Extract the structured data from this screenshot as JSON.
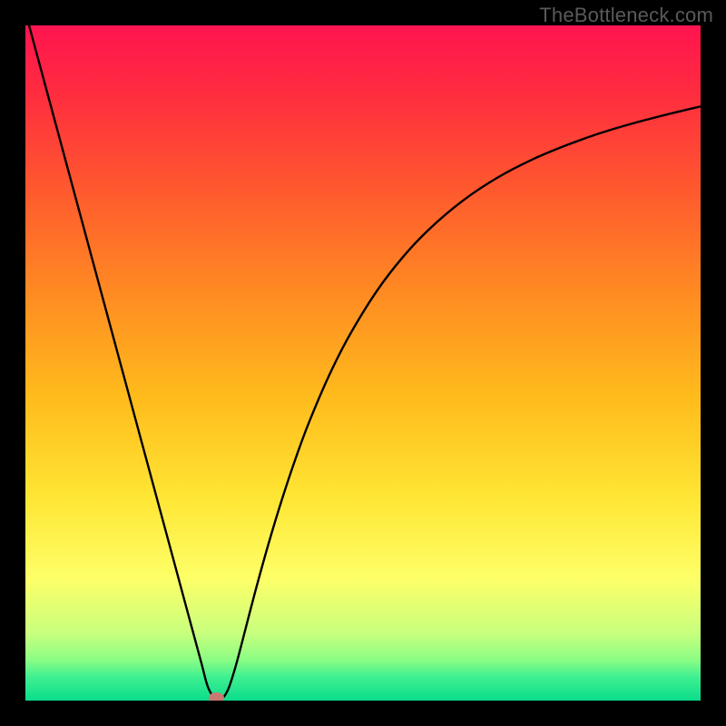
{
  "watermark": "TheBottleneck.com",
  "chart_data": {
    "type": "line",
    "title": "",
    "xlabel": "",
    "ylabel": "",
    "xlim": [
      0,
      100
    ],
    "ylim": [
      0,
      100
    ],
    "grid": false,
    "background_gradient": {
      "stops": [
        {
          "pos": 0.0,
          "color": "#ff1450"
        },
        {
          "pos": 0.1,
          "color": "#ff2c3f"
        },
        {
          "pos": 0.25,
          "color": "#ff5b2e"
        },
        {
          "pos": 0.4,
          "color": "#ff8c22"
        },
        {
          "pos": 0.55,
          "color": "#ffbb1c"
        },
        {
          "pos": 0.7,
          "color": "#ffe634"
        },
        {
          "pos": 0.82,
          "color": "#fdff68"
        },
        {
          "pos": 0.9,
          "color": "#c8ff7d"
        },
        {
          "pos": 0.94,
          "color": "#8bfd84"
        },
        {
          "pos": 0.965,
          "color": "#3ff090"
        },
        {
          "pos": 1.0,
          "color": "#0bdc8b"
        }
      ]
    },
    "series": [
      {
        "name": "bottleneck-curve",
        "type": "line",
        "color": "#000000",
        "width": 2.4,
        "x": [
          0,
          2,
          4,
          6,
          8,
          10,
          12,
          14,
          16,
          18,
          20,
          22,
          24,
          26,
          27,
          28,
          29,
          30,
          31,
          32,
          34,
          36,
          38,
          40,
          42,
          45,
          48,
          52,
          56,
          60,
          65,
          70,
          75,
          80,
          85,
          90,
          95,
          100
        ],
        "y": [
          102,
          94.6,
          87.2,
          79.8,
          72.4,
          65.0,
          57.6,
          50.2,
          42.8,
          35.4,
          28.0,
          20.6,
          13.2,
          5.8,
          2.1,
          0.4,
          0.2,
          1.6,
          4.6,
          8.3,
          16.0,
          23.2,
          29.8,
          35.8,
          41.2,
          48.2,
          54.1,
          60.6,
          65.8,
          70.0,
          74.2,
          77.5,
          80.1,
          82.2,
          84.0,
          85.5,
          86.8,
          88.0
        ]
      }
    ],
    "marker": {
      "x": 28.3,
      "y": 0.4,
      "rx": 1.1,
      "ry": 0.8,
      "color": "#c77a72"
    }
  }
}
